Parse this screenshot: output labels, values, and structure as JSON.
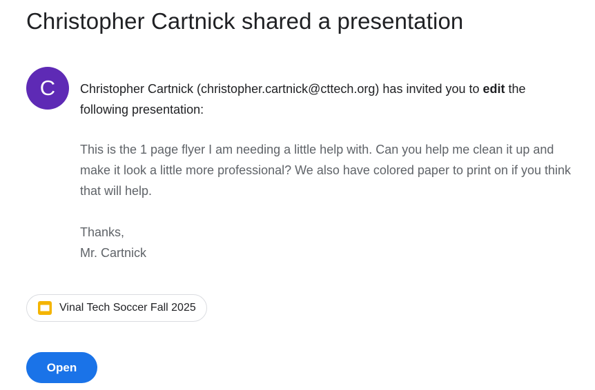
{
  "header": {
    "title": "Christopher Cartnick shared a presentation"
  },
  "sender": {
    "avatar_initial": "C",
    "avatar_color": "#5e2ab5"
  },
  "invite": {
    "prefix": "Christopher Cartnick (christopher.cartnick@cttech.org) has invited you to ",
    "permission": "edit",
    "suffix": " the following presentation:"
  },
  "message": {
    "body": "This is the 1 page flyer I am needing a little help with. Can you help me clean it up and make it look a little more professional? We also have colored paper to print on if you think that will help.",
    "closing": "Thanks,",
    "signature": "Mr. Cartnick"
  },
  "attachment": {
    "icon": "google-slides-icon",
    "icon_color": "#f4b400",
    "label": "Vinal Tech Soccer Fall 2025"
  },
  "actions": {
    "open_label": "Open",
    "open_color": "#1a73e8"
  }
}
